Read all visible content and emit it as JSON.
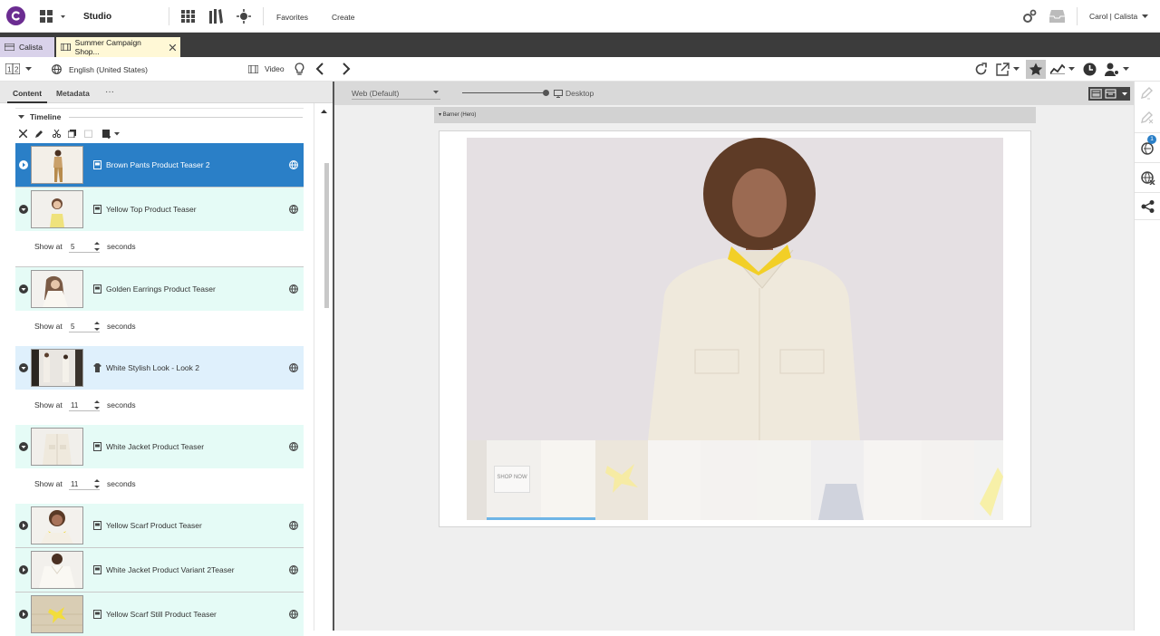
{
  "app": {
    "name": "Studio"
  },
  "topnav": {
    "favorites": "Favorites",
    "create": "Create",
    "user": "Carol | Calista"
  },
  "tabs": [
    {
      "label": "Calista"
    },
    {
      "label": "Summer Campaign Shop..."
    }
  ],
  "toolbar": {
    "locale": "English (United States)",
    "doc_type": "Video"
  },
  "subtabs": {
    "content": "Content",
    "metadata": "Metadata",
    "more": "···"
  },
  "timeline": {
    "title": "Timeline",
    "items": [
      {
        "title": "Brown Pants Product Teaser 2",
        "selected": true,
        "expanded": false,
        "type_icon": "teaser-icon"
      },
      {
        "title": "Yellow Top Product Teaser",
        "expanded": true,
        "show_at": "5",
        "type_icon": "teaser-icon"
      },
      {
        "title": "Golden Earrings Product Teaser",
        "expanded": true,
        "show_at": "5",
        "type_icon": "teaser-icon"
      },
      {
        "title": "White Stylish Look - Look 2",
        "expanded": true,
        "show_at": "11",
        "type_icon": "look-icon"
      },
      {
        "title": "White Jacket Product Teaser",
        "expanded": true,
        "show_at": "11",
        "type_icon": "teaser-icon"
      },
      {
        "title": "Yellow Scarf Product Teaser",
        "expanded": false,
        "type_icon": "teaser-icon"
      },
      {
        "title": "White Jacket Product Variant 2Teaser",
        "expanded": false,
        "type_icon": "teaser-icon"
      },
      {
        "title": "Yellow Scarf Still Product Teaser",
        "expanded": false,
        "type_icon": "teaser-icon"
      }
    ],
    "show_at_label": "Show at",
    "seconds_label": "seconds"
  },
  "preview": {
    "channel": "Web (Default)",
    "device": "Desktop",
    "banner_label": "Barner (Hero)",
    "cta": "SHOP NOW"
  },
  "rail": {
    "badge": "1"
  },
  "colors": {
    "accent": "#2a7fc7",
    "selected_row": "#2a7fc7",
    "row_bg": "#e5fbf6",
    "look_row": "#dff0fc",
    "brand": "#6b2c91"
  }
}
